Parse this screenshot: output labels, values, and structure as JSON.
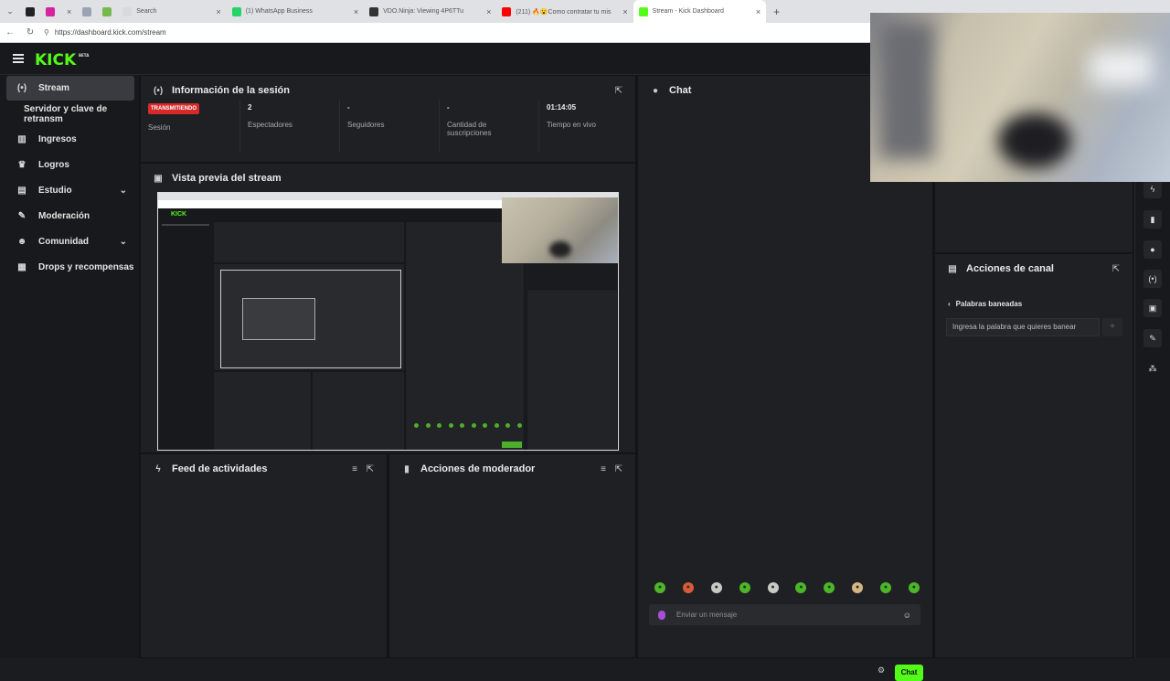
{
  "browser": {
    "tabs": [
      {
        "label": "",
        "fav_color": "#222222"
      },
      {
        "label": "",
        "fav_color": "#d6249f"
      },
      {
        "label": "",
        "fav_color": "#9aa3b5"
      },
      {
        "label": "",
        "fav_color": "#76b84d"
      },
      {
        "label": "Search",
        "fav_color": "#d9d9d9"
      },
      {
        "label": "(1) WhatsApp Business",
        "fav_color": "#25d366"
      },
      {
        "label": "VDO.Ninja: Viewing 4P6TTu",
        "fav_color": "#333333"
      },
      {
        "label": "(211) 🔥😮Como contratar tu mis",
        "fav_color": "#ff0000"
      },
      {
        "label": "Stream - Kick Dashboard",
        "fav_color": "#53fc18"
      }
    ],
    "url": "https://dashboard.kick.com/stream"
  },
  "app": {
    "logo": "KICK",
    "logo_sup": "BETA",
    "accent": "#53fc18"
  },
  "sidebar": {
    "items": [
      {
        "label": "Stream",
        "icon": "broadcast-icon",
        "glyph": "(•)"
      },
      {
        "label": "Servidor y clave de retransm",
        "icon": "",
        "glyph": ""
      },
      {
        "label": "Ingresos",
        "icon": "bar-chart-icon",
        "glyph": "▥"
      },
      {
        "label": "Logros",
        "icon": "trophy-icon",
        "glyph": "🏆"
      },
      {
        "label": "Estudio",
        "icon": "studio-icon",
        "glyph": "▤"
      },
      {
        "label": "Moderación",
        "icon": "wrench-icon",
        "glyph": "🔧"
      },
      {
        "label": "Comunidad",
        "icon": "community-icon",
        "glyph": "👥"
      },
      {
        "label": "Drops y recompensas",
        "icon": "drops-icon",
        "glyph": "▦"
      }
    ]
  },
  "session": {
    "title": "Información de la sesión",
    "badge": "TRANSMITIENDO",
    "stats": [
      {
        "value": "",
        "label": "Sesión"
      },
      {
        "value": "2",
        "label": "Espectadores"
      },
      {
        "value": "-",
        "label": "Seguidores"
      },
      {
        "value": "-",
        "label": "Cantidad de suscripciones"
      },
      {
        "value": "01:14:05",
        "label": "Tiempo en vivo"
      }
    ]
  },
  "preview": {
    "title": "Vista previa del stream"
  },
  "feed": {
    "title": "Feed de actividades"
  },
  "modactions": {
    "title": "Acciones de moderador"
  },
  "chat": {
    "title": "Chat",
    "input_placeholder": "Enviar un mensaje",
    "send_label": "Chat"
  },
  "channel_actions": {
    "title": "Acciones de canal",
    "banned_header": "Palabras baneadas",
    "banned_placeholder": "Ingresa la palabra que quieres banear",
    "add_label": "+"
  }
}
